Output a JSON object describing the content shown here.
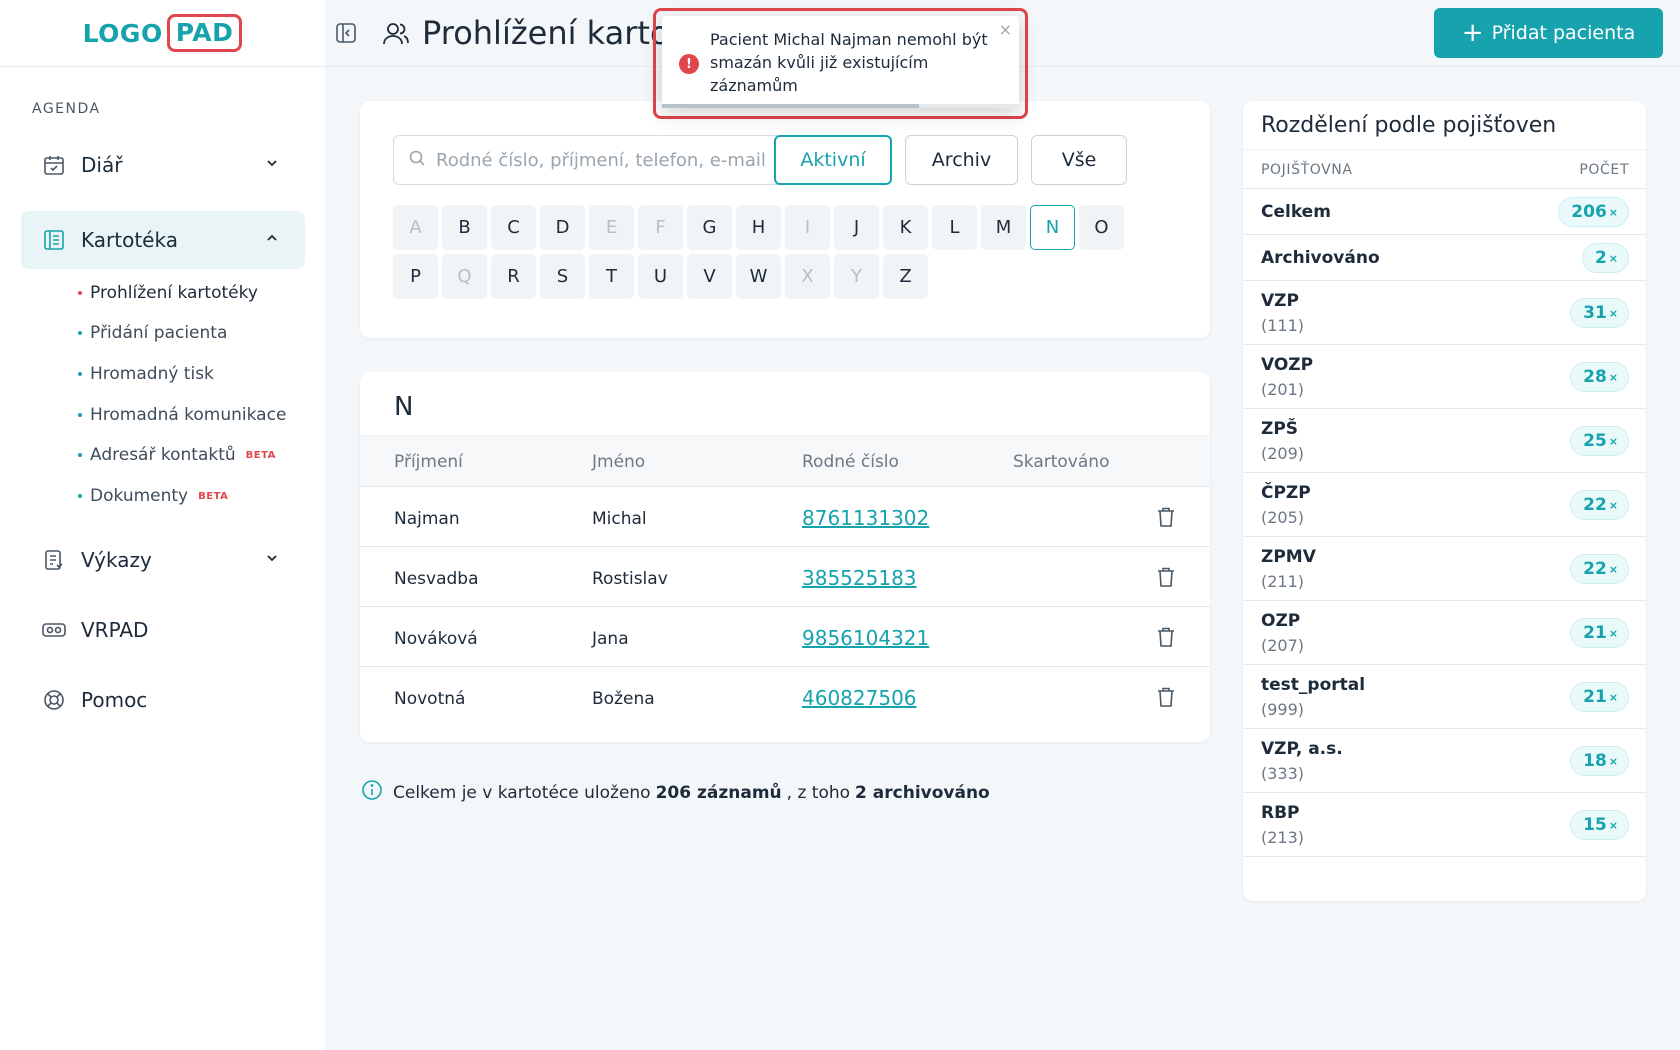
{
  "logo": {
    "part1": "LOGO",
    "part2": "PAD"
  },
  "sidebar": {
    "section": "AGENDA",
    "items": [
      {
        "label": "Diář",
        "icon": "calendar-icon"
      },
      {
        "label": "Kartotéka",
        "icon": "file-card-icon"
      },
      {
        "label": "Výkazy",
        "icon": "report-icon"
      },
      {
        "label": "VRPAD",
        "icon": "vr-icon"
      },
      {
        "label": "Pomoc",
        "icon": "lifebuoy-icon"
      }
    ],
    "subitems": [
      {
        "label": "Prohlížení kartotéky",
        "badge": ""
      },
      {
        "label": "Přidání pacienta",
        "badge": ""
      },
      {
        "label": "Hromadný tisk",
        "badge": ""
      },
      {
        "label": "Hromadná komunikace",
        "badge": ""
      },
      {
        "label": "Adresář kontaktů",
        "badge": "BETA"
      },
      {
        "label": "Dokumenty",
        "badge": "BETA"
      }
    ]
  },
  "header": {
    "title": "Prohlížení kartotéky",
    "add_button": "Přidat pacienta"
  },
  "search": {
    "placeholder": "Rodné číslo, příjmení, telefon, e-mail",
    "filters": [
      "Aktivní",
      "Archiv",
      "Vše"
    ],
    "active_filter": "Aktivní"
  },
  "letters": {
    "row1": [
      "A",
      "B",
      "C",
      "D",
      "E",
      "F",
      "G",
      "H",
      "I",
      "J",
      "K",
      "L",
      "M",
      "N",
      "O"
    ],
    "row2": [
      "P",
      "Q",
      "R",
      "S",
      "T",
      "U",
      "V",
      "W",
      "X",
      "Y",
      "Z"
    ],
    "disabled": [
      "A",
      "E",
      "F",
      "I",
      "Q",
      "X",
      "Y"
    ],
    "active": "N"
  },
  "table": {
    "group": "N",
    "columns": [
      "Příjmení",
      "Jméno",
      "Rodné číslo",
      "Skartováno"
    ],
    "rows": [
      {
        "surname": "Najman",
        "name": "Michal",
        "birth_no": "8761131302"
      },
      {
        "surname": "Nesvadba",
        "name": "Rostislav",
        "birth_no": "385525183"
      },
      {
        "surname": "Nováková",
        "name": "Jana",
        "birth_no": "9856104321"
      },
      {
        "surname": "Novotná",
        "name": "Božena",
        "birth_no": "460827506"
      }
    ]
  },
  "summary": {
    "pre": "Celkem je v kartotéce uloženo",
    "total": "206 záznamů",
    "mid": ", z toho",
    "archived": "2 archivováno"
  },
  "insurance": {
    "title": "Rozdělení podle pojišťoven",
    "col_name": "POJIŠŤOVNA",
    "col_count": "POČET",
    "rows": [
      {
        "name": "Celkem",
        "code": "",
        "count": "206"
      },
      {
        "name": "Archivováno",
        "code": "",
        "count": "2"
      },
      {
        "name": "VZP",
        "code": "(111)",
        "count": "31"
      },
      {
        "name": "VOZP",
        "code": "(201)",
        "count": "28"
      },
      {
        "name": "ZPŠ",
        "code": "(209)",
        "count": "25"
      },
      {
        "name": "ČPZP",
        "code": "(205)",
        "count": "22"
      },
      {
        "name": "ZPMV",
        "code": "(211)",
        "count": "22"
      },
      {
        "name": "OZP",
        "code": "(207)",
        "count": "21"
      },
      {
        "name": "test_portal",
        "code": "(999)",
        "count": "21"
      },
      {
        "name": "VZP, a.s.",
        "code": "(333)",
        "count": "18"
      },
      {
        "name": "RBP",
        "code": "(213)",
        "count": "15"
      }
    ],
    "count_suffix": "×"
  },
  "toast": {
    "message": "Pacient Michal Najman nemohl být smazán kvůli již existujícím záznamům",
    "close": "×",
    "progress": 0.72
  },
  "colors": {
    "accent": "#16a3ad",
    "danger": "#e0464b"
  }
}
